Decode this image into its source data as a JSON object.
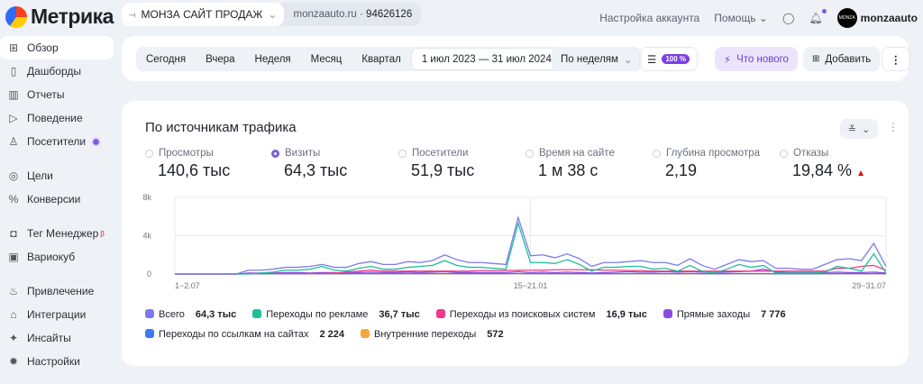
{
  "app": {
    "name": "Метрика"
  },
  "counter": {
    "name": "МОНЗА САЙТ ПРОДАЖ",
    "domain": "monzaauto.ru",
    "id": "94626126"
  },
  "topnav": {
    "account_settings": "Настройка аккаунта",
    "help": "Помощь",
    "user": "monzaauto",
    "avatar_text": "MONZA"
  },
  "sidebar": {
    "items": [
      {
        "label": "Обзор",
        "icon": "grid-icon",
        "active": true
      },
      {
        "label": "Дашборды",
        "icon": "dashboard-icon"
      },
      {
        "label": "Отчеты",
        "icon": "bar-chart-icon"
      },
      {
        "label": "Поведение",
        "icon": "play-icon"
      },
      {
        "label": "Посетители",
        "icon": "user-icon",
        "dot": true
      },
      {
        "label": "Цели",
        "icon": "target-icon"
      },
      {
        "label": "Конверсии",
        "icon": "percent-icon"
      },
      {
        "label": "Тег Менеджер",
        "icon": "tag-manager-icon",
        "badge": "β"
      },
      {
        "label": "Вариокуб",
        "icon": "variocube-icon"
      },
      {
        "label": "Привлечение",
        "icon": "flame-icon"
      },
      {
        "label": "Интеграции",
        "icon": "puzzle-icon"
      },
      {
        "label": "Инсайты",
        "icon": "sparkle-icon"
      },
      {
        "label": "Настройки",
        "icon": "gear-icon"
      }
    ]
  },
  "toolbar": {
    "periods": [
      "Сегодня",
      "Вчера",
      "Неделя",
      "Месяц",
      "Квартал"
    ],
    "date_range": "1 июл 2023 — 31 июл 2024",
    "grouping": "По неделям",
    "sampling": "100 %",
    "whats_new": "Что нового",
    "add": "Добавить"
  },
  "report": {
    "title": "По источникам трафика",
    "metrics": [
      {
        "label": "Просмотры",
        "value": "140,6 тыс",
        "selected": false
      },
      {
        "label": "Визиты",
        "value": "64,3 тыс",
        "selected": true
      },
      {
        "label": "Посетители",
        "value": "51,9 тыс",
        "selected": false
      },
      {
        "label": "Время на сайте",
        "value": "1 м 38 с",
        "selected": false
      },
      {
        "label": "Глубина просмотра",
        "value": "2,19",
        "selected": false
      },
      {
        "label": "Отказы",
        "value": "19,84 %",
        "selected": false,
        "trend": "up"
      }
    ]
  },
  "chart_data": {
    "type": "line",
    "y_ticks": [
      "0",
      "4k",
      "8k"
    ],
    "ylim": [
      0,
      8000
    ],
    "x_tick_labels": [
      "1−2.07",
      "15−21.01",
      "29−31.07"
    ],
    "grid": true,
    "series": [
      {
        "name": "Всего",
        "total": "64,3 тыс",
        "color": "#7b7bee",
        "values": [
          0,
          0,
          0,
          0,
          0,
          0,
          400,
          400,
          500,
          700,
          700,
          800,
          1000,
          700,
          700,
          1100,
          1300,
          1000,
          1000,
          1300,
          1200,
          1400,
          2000,
          1500,
          1200,
          1200,
          1100,
          1000,
          5900,
          1900,
          2000,
          1700,
          2100,
          1600,
          800,
          1200,
          1200,
          1300,
          1400,
          1200,
          1200,
          900,
          1600,
          900,
          500,
          1000,
          1500,
          1300,
          1400,
          600,
          600,
          500,
          500,
          1000,
          1500,
          1600,
          1400,
          3200,
          800
        ]
      },
      {
        "name": "Переходы по рекламе",
        "total": "36,7 тыс",
        "color": "#1fbf9b",
        "values": [
          0,
          0,
          0,
          0,
          0,
          0,
          0,
          100,
          200,
          400,
          400,
          500,
          800,
          400,
          300,
          600,
          800,
          500,
          500,
          700,
          800,
          900,
          1400,
          900,
          700,
          700,
          600,
          500,
          5300,
          1200,
          1200,
          1100,
          1500,
          1000,
          300,
          700,
          700,
          800,
          800,
          500,
          600,
          300,
          900,
          300,
          100,
          500,
          1000,
          700,
          900,
          100,
          100,
          100,
          100,
          200,
          800,
          600,
          300,
          2100,
          100
        ]
      },
      {
        "name": "Переходы из поисковых систем",
        "total": "16,9 тыс",
        "color": "#f0388c",
        "values": [
          0,
          0,
          0,
          0,
          0,
          0,
          50,
          50,
          50,
          50,
          50,
          50,
          50,
          100,
          200,
          300,
          400,
          300,
          300,
          300,
          300,
          300,
          300,
          300,
          300,
          350,
          350,
          350,
          400,
          400,
          400,
          450,
          450,
          450,
          450,
          400,
          400,
          350,
          350,
          300,
          300,
          300,
          300,
          300,
          300,
          300,
          300,
          300,
          300,
          300,
          300,
          300,
          300,
          300,
          600,
          600,
          800,
          900,
          400
        ]
      },
      {
        "name": "Прямые заходы",
        "total": "7 776",
        "color": "#8a4be0",
        "values": [
          0,
          0,
          0,
          0,
          0,
          0,
          100,
          100,
          100,
          150,
          150,
          100,
          150,
          150,
          100,
          150,
          200,
          150,
          150,
          200,
          150,
          200,
          250,
          150,
          150,
          150,
          150,
          150,
          250,
          150,
          200,
          150,
          200,
          150,
          100,
          150,
          200,
          250,
          200,
          200,
          250,
          200,
          250,
          200,
          150,
          200,
          250,
          300,
          500,
          200,
          150,
          150,
          150,
          150,
          200,
          150,
          150,
          200,
          100
        ]
      },
      {
        "name": "Переходы по ссылкам на сайтах",
        "total": "2 224",
        "color": "#3d78f5",
        "values": [
          0,
          0,
          0,
          0,
          0,
          0,
          20,
          20,
          30,
          30,
          30,
          40,
          40,
          30,
          30,
          40,
          40,
          40,
          40,
          40,
          40,
          50,
          50,
          40,
          40,
          40,
          40,
          40,
          50,
          40,
          40,
          40,
          40,
          40,
          30,
          40,
          40,
          40,
          50,
          40,
          40,
          40,
          50,
          40,
          30,
          40,
          40,
          40,
          50,
          30,
          30,
          30,
          30,
          40,
          40,
          40,
          40,
          50,
          30
        ]
      },
      {
        "name": "Внутренние переходы",
        "total": "572",
        "color": "#f5a742",
        "values": [
          0,
          0,
          0,
          0,
          0,
          0,
          10,
          10,
          10,
          10,
          10,
          10,
          10,
          10,
          10,
          10,
          10,
          10,
          10,
          10,
          10,
          10,
          10,
          10,
          10,
          10,
          10,
          10,
          20,
          10,
          10,
          10,
          10,
          10,
          10,
          10,
          10,
          10,
          10,
          10,
          10,
          10,
          10,
          10,
          10,
          10,
          10,
          10,
          10,
          10,
          10,
          10,
          10,
          10,
          10,
          10,
          10,
          10,
          10
        ]
      }
    ]
  }
}
